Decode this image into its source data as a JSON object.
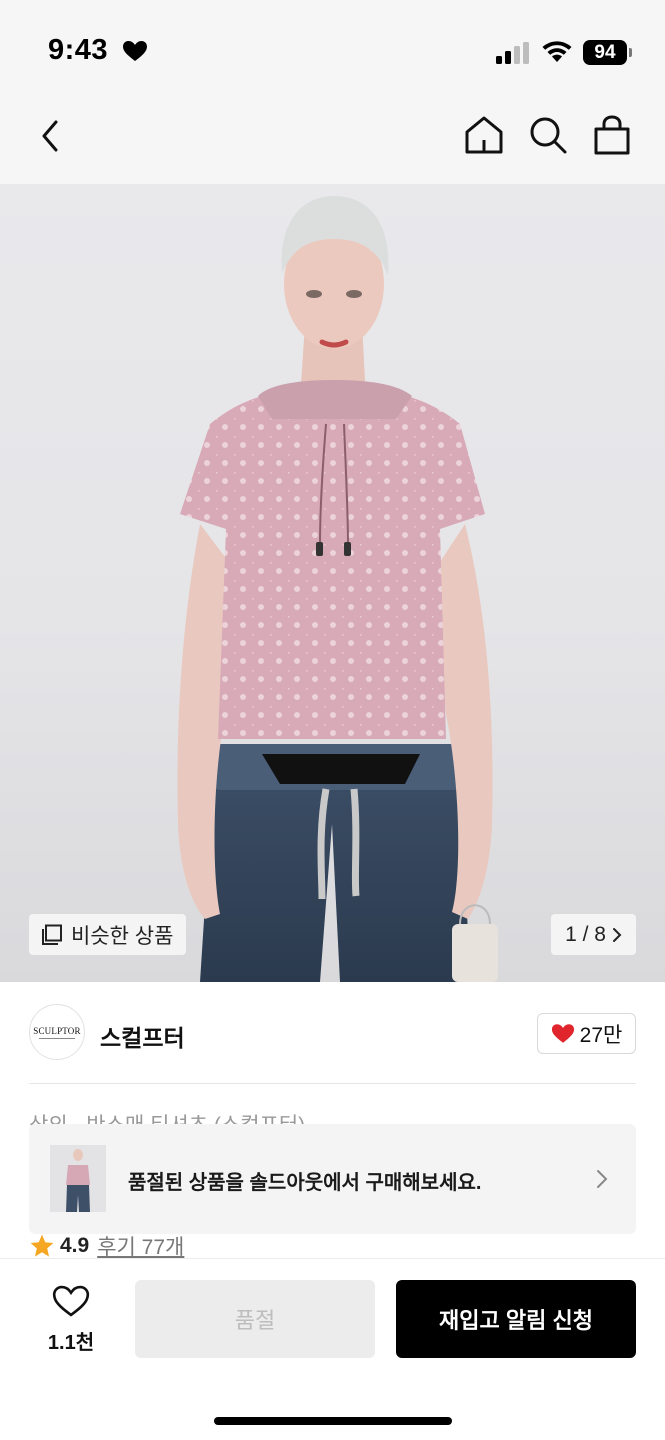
{
  "status_bar": {
    "time": "9:43",
    "battery": "94"
  },
  "nav": {
    "icons": [
      "back-arrow-icon",
      "home-icon",
      "search-icon",
      "shopping-bag-icon"
    ]
  },
  "hero": {
    "similar_label": "비슷한 상품",
    "page_counter": "1 / 8"
  },
  "brand": {
    "logo_text": "SCULPTOR",
    "name": "스컬프터",
    "likes": "27만",
    "like_color": "#e0252d"
  },
  "product": {
    "title": "상의 · 반소매 티셔츠 (스컬프터)"
  },
  "soldout_banner": {
    "text": "품절된 상품을 솔드아웃에서 구매해보세요."
  },
  "rating": {
    "score": "4.9",
    "reviews": "후기 77개",
    "star_color": "#f5a623"
  },
  "bottom_bar": {
    "wish_count": "1.1천",
    "soldout_label": "품절",
    "restock_label": "재입고 알림 신청"
  }
}
